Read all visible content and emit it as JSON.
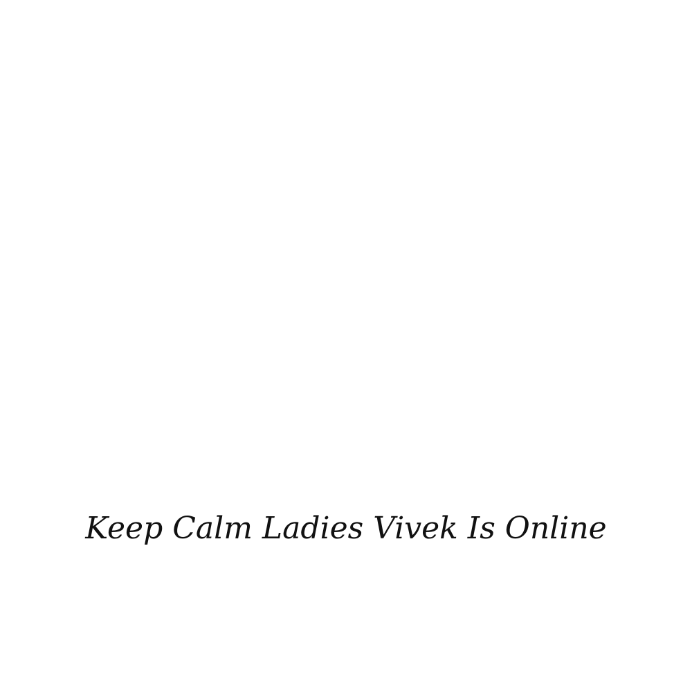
{
  "caption": {
    "text": "Keep Calm Ladies Vivek Is Online"
  },
  "colors": {
    "background": "#ffffff",
    "text": "#111111"
  }
}
